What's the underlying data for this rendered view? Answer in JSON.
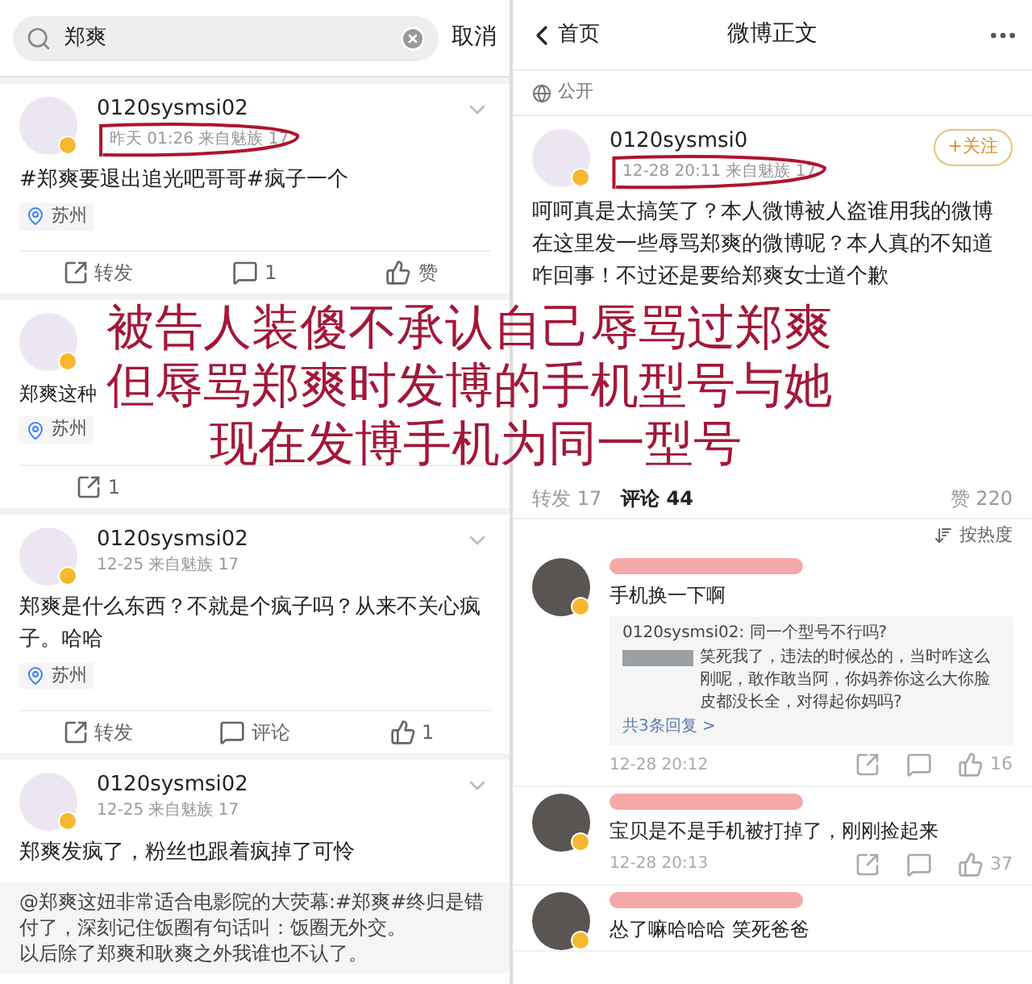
{
  "left": {
    "search": {
      "value": "郑爽",
      "cancel": "取消"
    },
    "posts": [
      {
        "user": "0120sysmsi02",
        "meta": "昨天 01:26 来自魅族 17",
        "circled": true,
        "text": "#郑爽要退出追光吧哥哥#疯子一个",
        "location": "苏州",
        "actions": [
          {
            "kind": "repost",
            "label": "转发"
          },
          {
            "kind": "comment",
            "label": "1"
          },
          {
            "kind": "like",
            "label": "赞"
          }
        ]
      },
      {
        "text": "郑爽这种",
        "location": "苏州",
        "actions": [
          {
            "kind": "repost",
            "label": "1"
          }
        ]
      },
      {
        "user": "0120sysmsi02",
        "meta": "12-25 来自魅族 17",
        "text": "郑爽是什么东西？不就是个疯子吗？从来不关心疯子。哈哈",
        "location": "苏州",
        "actions": [
          {
            "kind": "repost",
            "label": "转发"
          },
          {
            "kind": "comment",
            "label": "评论"
          },
          {
            "kind": "like",
            "label": "1"
          }
        ]
      },
      {
        "user": "0120sysmsi02",
        "meta": "12-25 来自魅族 17",
        "text": "郑爽发疯了，粉丝也跟着疯掉了可怜",
        "repost": [
          "@郑爽这妞非常适合电影院的大荧幕:#郑爽#终归是错付了，深刻记住饭圈有句话叫：饭圈无外交。",
          "以后除了郑爽和耿爽之外我谁也不认了。"
        ]
      }
    ]
  },
  "right": {
    "nav": {
      "back": "首页",
      "title": "微博正文"
    },
    "visibility": "公开",
    "post": {
      "user": "0120sysmsi0",
      "meta": "12-28 20:11 来自魅族 17",
      "circled": true,
      "follow": "+关注",
      "text": "呵呵真是太搞笑了？本人微博被人盗谁用我的微博在这里发一些辱骂郑爽的微博呢？本人真的不知道咋回事！不过还是要给郑爽女士道个歉"
    },
    "tabs": [
      {
        "label": "转发 17",
        "selected": false
      },
      {
        "label": "评论 44",
        "selected": true
      }
    ],
    "likes": "赞 220",
    "sort": "按热度",
    "comments": [
      {
        "text": "手机换一下啊",
        "name_redacted": true,
        "reply": {
          "first": "0120sysmsi02: 同一个型号不行吗?",
          "second": "笑死我了，违法的时候怂的，当时咋这么刚呢，敢作敢当阿，你妈养你这么大你脸皮都没长全，对得起你妈吗?",
          "more": "共3条回复 >"
        },
        "time": "12-28 20:12",
        "likes": "16"
      },
      {
        "text": "宝贝是不是手机被打掉了，刚刚捡起来",
        "name_redacted": true,
        "time": "12-28 20:13",
        "likes": "37"
      },
      {
        "text": "怂了嘛哈哈哈 笑死爸爸",
        "name_redacted": true
      }
    ]
  },
  "annotation": {
    "lines": [
      "被告人装傻不承认自己辱骂过郑爽",
      "但辱骂郑爽时发博的手机型号与她",
      "现在发博手机为同一型号"
    ]
  }
}
